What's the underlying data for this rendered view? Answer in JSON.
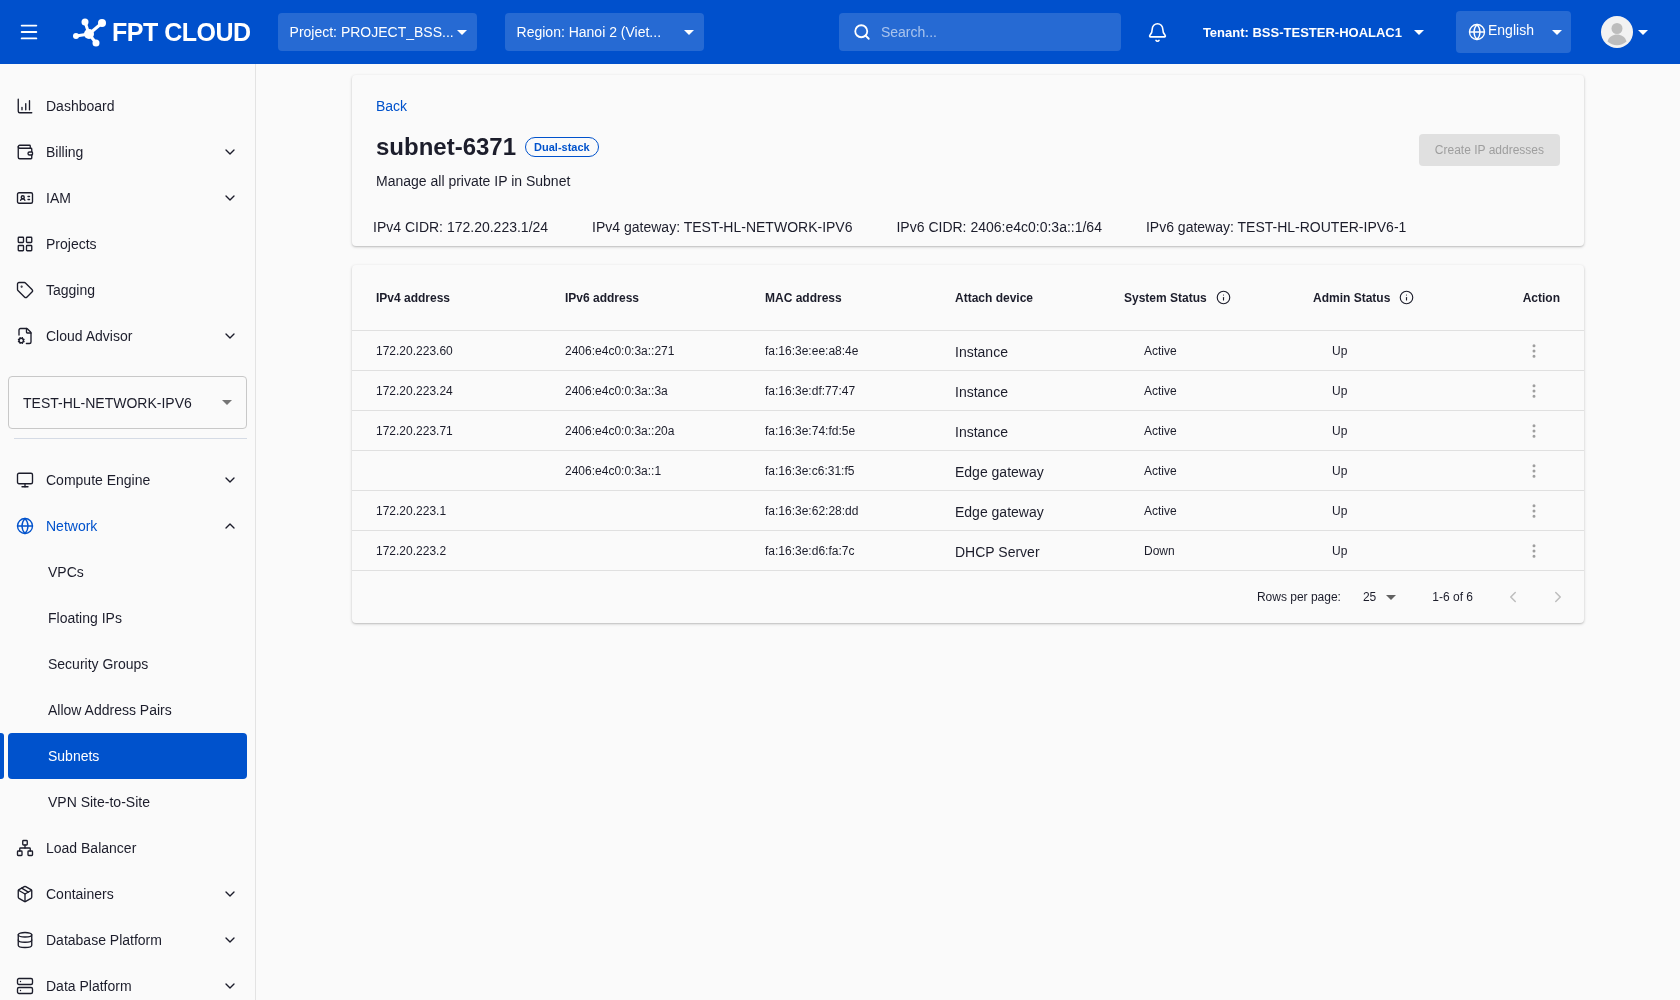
{
  "topbar": {
    "logo_text": "FPT CLOUD",
    "project": "Project: PROJECT_BSS...",
    "region": "Region: Hanoi 2 (Viet...",
    "search": {
      "placeholder": "Search..."
    },
    "tenant": "Tenant: BSS-TESTER-HOALAC1",
    "language": "English"
  },
  "sidebar": {
    "top_items": [
      {
        "label": "Dashboard",
        "kind": "link"
      },
      {
        "label": "Billing",
        "kind": "group",
        "expanded": false
      },
      {
        "label": "IAM",
        "kind": "group",
        "expanded": false
      },
      {
        "label": "Projects",
        "kind": "link"
      },
      {
        "label": "Tagging",
        "kind": "link"
      },
      {
        "label": "Cloud Advisor",
        "kind": "group",
        "expanded": false
      }
    ],
    "project_select": "TEST-HL-NETWORK-IPV6",
    "items": [
      {
        "label": "Compute Engine",
        "kind": "group",
        "expanded": false
      },
      {
        "label": "Network",
        "kind": "group",
        "expanded": true,
        "children": [
          {
            "label": "VPCs",
            "selected": false
          },
          {
            "label": "Floating IPs",
            "selected": false
          },
          {
            "label": "Security Groups",
            "selected": false
          },
          {
            "label": "Allow Address Pairs",
            "selected": false
          },
          {
            "label": "Subnets",
            "selected": true
          },
          {
            "label": "VPN Site-to-Site",
            "selected": false
          }
        ]
      },
      {
        "label": "Load Balancer",
        "kind": "link"
      },
      {
        "label": "Containers",
        "kind": "group",
        "expanded": false
      },
      {
        "label": "Database Platform",
        "kind": "group",
        "expanded": false
      },
      {
        "label": "Data Platform",
        "kind": "group",
        "expanded": false
      }
    ]
  },
  "page": {
    "back_link": "Back",
    "title": "subnet-6371",
    "badge": "Dual-stack",
    "description": "Manage all private IP in Subnet",
    "create_button": {
      "label": "Create IP addresses",
      "disabled": true
    },
    "details": [
      "IPv4 CIDR: 172.20.223.1/24",
      "IPv4 gateway: TEST-HL-NETWORK-IPV6",
      "IPv6 CIDR: 2406:e4c0:0:3a::1/64",
      "IPv6 gateway: TEST-HL-ROUTER-IPV6-1"
    ]
  },
  "table": {
    "columns": [
      {
        "label": "IPv4 address",
        "info": false
      },
      {
        "label": "IPv6 address",
        "info": false
      },
      {
        "label": "MAC address",
        "info": false
      },
      {
        "label": "Attach device",
        "info": false
      },
      {
        "label": "System Status",
        "info": true
      },
      {
        "label": "Admin Status",
        "info": true
      },
      {
        "label": "Action",
        "info": false
      }
    ],
    "rows": [
      {
        "ipv4": "172.20.223.60",
        "ipv6": "2406:e4c0:0:3a::271",
        "mac": "fa:16:3e:ee:a8:4e",
        "device": "Instance",
        "system_status": "Active",
        "admin_status": "Up"
      },
      {
        "ipv4": "172.20.223.24",
        "ipv6": "2406:e4c0:0:3a::3a",
        "mac": "fa:16:3e:df:77:47",
        "device": "Instance",
        "system_status": "Active",
        "admin_status": "Up"
      },
      {
        "ipv4": "172.20.223.71",
        "ipv6": "2406:e4c0:0:3a::20a",
        "mac": "fa:16:3e:74:fd:5e",
        "device": "Instance",
        "system_status": "Active",
        "admin_status": "Up"
      },
      {
        "ipv6": "2406:e4c0:0:3a::1",
        "mac": "fa:16:3e:c6:31:f5",
        "device": "Edge gateway",
        "system_status": "Active",
        "admin_status": "Up"
      },
      {
        "ipv4": "172.20.223.1",
        "mac": "fa:16:3e:62:28:dd",
        "device": "Edge gateway",
        "system_status": "Active",
        "admin_status": "Up"
      },
      {
        "ipv4": "172.20.223.2",
        "mac": "fa:16:3e:d6:fa:7c",
        "device": "DHCP Server",
        "system_status": "Down",
        "admin_status": "Up"
      }
    ],
    "pagination": {
      "rows_per_page_label": "Rows per page:",
      "rows_per_page": "25",
      "range": "1-6 of 6",
      "prev_disabled": true,
      "next_disabled": true
    }
  }
}
